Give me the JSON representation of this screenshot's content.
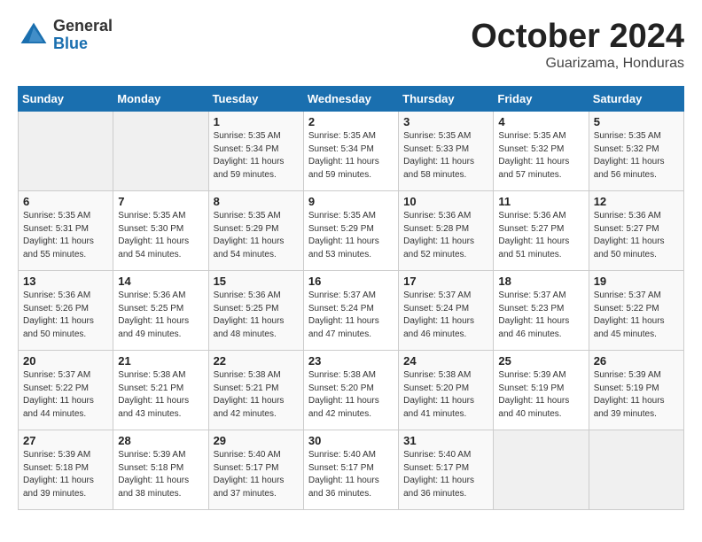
{
  "header": {
    "logo_general": "General",
    "logo_blue": "Blue",
    "month_title": "October 2024",
    "location": "Guarizama, Honduras"
  },
  "calendar": {
    "weekdays": [
      "Sunday",
      "Monday",
      "Tuesday",
      "Wednesday",
      "Thursday",
      "Friday",
      "Saturday"
    ],
    "weeks": [
      [
        {
          "day": "",
          "info": ""
        },
        {
          "day": "",
          "info": ""
        },
        {
          "day": "1",
          "info": "Sunrise: 5:35 AM\nSunset: 5:34 PM\nDaylight: 11 hours\nand 59 minutes."
        },
        {
          "day": "2",
          "info": "Sunrise: 5:35 AM\nSunset: 5:34 PM\nDaylight: 11 hours\nand 59 minutes."
        },
        {
          "day": "3",
          "info": "Sunrise: 5:35 AM\nSunset: 5:33 PM\nDaylight: 11 hours\nand 58 minutes."
        },
        {
          "day": "4",
          "info": "Sunrise: 5:35 AM\nSunset: 5:32 PM\nDaylight: 11 hours\nand 57 minutes."
        },
        {
          "day": "5",
          "info": "Sunrise: 5:35 AM\nSunset: 5:32 PM\nDaylight: 11 hours\nand 56 minutes."
        }
      ],
      [
        {
          "day": "6",
          "info": "Sunrise: 5:35 AM\nSunset: 5:31 PM\nDaylight: 11 hours\nand 55 minutes."
        },
        {
          "day": "7",
          "info": "Sunrise: 5:35 AM\nSunset: 5:30 PM\nDaylight: 11 hours\nand 54 minutes."
        },
        {
          "day": "8",
          "info": "Sunrise: 5:35 AM\nSunset: 5:29 PM\nDaylight: 11 hours\nand 54 minutes."
        },
        {
          "day": "9",
          "info": "Sunrise: 5:35 AM\nSunset: 5:29 PM\nDaylight: 11 hours\nand 53 minutes."
        },
        {
          "day": "10",
          "info": "Sunrise: 5:36 AM\nSunset: 5:28 PM\nDaylight: 11 hours\nand 52 minutes."
        },
        {
          "day": "11",
          "info": "Sunrise: 5:36 AM\nSunset: 5:27 PM\nDaylight: 11 hours\nand 51 minutes."
        },
        {
          "day": "12",
          "info": "Sunrise: 5:36 AM\nSunset: 5:27 PM\nDaylight: 11 hours\nand 50 minutes."
        }
      ],
      [
        {
          "day": "13",
          "info": "Sunrise: 5:36 AM\nSunset: 5:26 PM\nDaylight: 11 hours\nand 50 minutes."
        },
        {
          "day": "14",
          "info": "Sunrise: 5:36 AM\nSunset: 5:25 PM\nDaylight: 11 hours\nand 49 minutes."
        },
        {
          "day": "15",
          "info": "Sunrise: 5:36 AM\nSunset: 5:25 PM\nDaylight: 11 hours\nand 48 minutes."
        },
        {
          "day": "16",
          "info": "Sunrise: 5:37 AM\nSunset: 5:24 PM\nDaylight: 11 hours\nand 47 minutes."
        },
        {
          "day": "17",
          "info": "Sunrise: 5:37 AM\nSunset: 5:24 PM\nDaylight: 11 hours\nand 46 minutes."
        },
        {
          "day": "18",
          "info": "Sunrise: 5:37 AM\nSunset: 5:23 PM\nDaylight: 11 hours\nand 46 minutes."
        },
        {
          "day": "19",
          "info": "Sunrise: 5:37 AM\nSunset: 5:22 PM\nDaylight: 11 hours\nand 45 minutes."
        }
      ],
      [
        {
          "day": "20",
          "info": "Sunrise: 5:37 AM\nSunset: 5:22 PM\nDaylight: 11 hours\nand 44 minutes."
        },
        {
          "day": "21",
          "info": "Sunrise: 5:38 AM\nSunset: 5:21 PM\nDaylight: 11 hours\nand 43 minutes."
        },
        {
          "day": "22",
          "info": "Sunrise: 5:38 AM\nSunset: 5:21 PM\nDaylight: 11 hours\nand 42 minutes."
        },
        {
          "day": "23",
          "info": "Sunrise: 5:38 AM\nSunset: 5:20 PM\nDaylight: 11 hours\nand 42 minutes."
        },
        {
          "day": "24",
          "info": "Sunrise: 5:38 AM\nSunset: 5:20 PM\nDaylight: 11 hours\nand 41 minutes."
        },
        {
          "day": "25",
          "info": "Sunrise: 5:39 AM\nSunset: 5:19 PM\nDaylight: 11 hours\nand 40 minutes."
        },
        {
          "day": "26",
          "info": "Sunrise: 5:39 AM\nSunset: 5:19 PM\nDaylight: 11 hours\nand 39 minutes."
        }
      ],
      [
        {
          "day": "27",
          "info": "Sunrise: 5:39 AM\nSunset: 5:18 PM\nDaylight: 11 hours\nand 39 minutes."
        },
        {
          "day": "28",
          "info": "Sunrise: 5:39 AM\nSunset: 5:18 PM\nDaylight: 11 hours\nand 38 minutes."
        },
        {
          "day": "29",
          "info": "Sunrise: 5:40 AM\nSunset: 5:17 PM\nDaylight: 11 hours\nand 37 minutes."
        },
        {
          "day": "30",
          "info": "Sunrise: 5:40 AM\nSunset: 5:17 PM\nDaylight: 11 hours\nand 36 minutes."
        },
        {
          "day": "31",
          "info": "Sunrise: 5:40 AM\nSunset: 5:17 PM\nDaylight: 11 hours\nand 36 minutes."
        },
        {
          "day": "",
          "info": ""
        },
        {
          "day": "",
          "info": ""
        }
      ]
    ]
  }
}
